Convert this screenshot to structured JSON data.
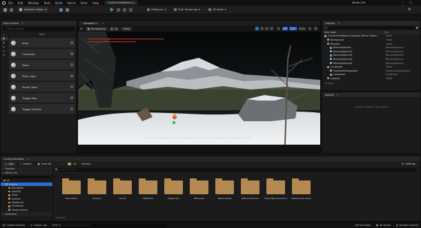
{
  "menu": [
    "File",
    "Edit",
    "Window",
    "Tools",
    "Build",
    "Select",
    "Actor",
    "Help"
  ],
  "project_tab": "ConiferForestBiome_S",
  "window_title": "Winter_Fire",
  "toolbar": {
    "mode": "Selection Mode",
    "platforms": "Platforms",
    "pixel_streaming": "Pixel Streaming",
    "vr_mode": "VR Mode"
  },
  "place_actors": {
    "title": "Place Actors",
    "search_placeholder": "Search Classes",
    "categories": [
      "Basic",
      "Lights",
      "Shapes",
      "Visual",
      "Volumes",
      "All Classes"
    ],
    "section_label": "Basic",
    "items": [
      "Actor",
      "Character",
      "Pawn",
      "Point Light",
      "Player Start",
      "Trigger Box",
      "Trigger Sphere"
    ]
  },
  "viewport": {
    "tab": "Viewport 1",
    "perspective": "Perspective",
    "lit": "Lit",
    "show": "Show",
    "grid_snap": "10",
    "rot_snap": "10°",
    "scale_snap": "0.25",
    "camera_speed": "4",
    "message": "No active Level Sequencer Editor detected. Please edit a Level Sequence to enable full controls."
  },
  "outliner": {
    "title": "Outliner",
    "col_label": "Item Label",
    "col_type": "Type",
    "rows": [
      {
        "label": "ConiferForestBiome_Example_Winter (Editor)",
        "type": "World",
        "indent": 0
      },
      {
        "label": "Background",
        "type": "Folder",
        "indent": 1
      },
      {
        "label": "Blockers",
        "type": "Folder",
        "indent": 1
      },
      {
        "label": "BlockingVolume",
        "type": "BlockingVolume",
        "indent": 2
      },
      {
        "label": "BlockingVolume2",
        "type": "BlockingVolume",
        "indent": 2
      },
      {
        "label": "BlockingVolume3",
        "type": "BlockingVolume",
        "indent": 2
      },
      {
        "label": "BlockingVolume4",
        "type": "BlockingVolume",
        "indent": 2
      },
      {
        "label": "BlockingVolume5",
        "type": "BlockingVolume",
        "indent": 2
      },
      {
        "label": "Landscape",
        "type": "Folder",
        "indent": 1
      },
      {
        "label": "InstancedFoliageActor",
        "type": "InstancedFoliageActor",
        "indent": 2
      },
      {
        "label": "Landscape",
        "type": "Landscape",
        "indent": 2
      },
      {
        "label": "Lighting",
        "type": "Folder",
        "indent": 1
      }
    ],
    "count": "78 actors"
  },
  "details": {
    "title": "Details",
    "empty": "Select an object to view details."
  },
  "content_browser": {
    "title": "Content Browser",
    "add": "Add",
    "import": "Import",
    "save_all": "Save All",
    "path_all": "All",
    "path_content": "Content",
    "settings": "Settings",
    "favorites": "Favorites",
    "project": "Winter_Fire",
    "tree": [
      "All",
      "Content",
      "BlackWater",
      "EasyFog",
      "Fauna",
      "FirePack",
      "Megascans",
      "PCGWorlds",
      "StarterContent"
    ],
    "search_placeholder": "Search Content",
    "folders": [
      "BlackWater",
      "EasyFog",
      "FauIne",
      "FIREPACK1",
      "Megascans",
      "MSPresets",
      "NMChristmas",
      "NMConiferForest",
      "PhysicsBlockGenerics",
      "PWAdvanced Pack2"
    ],
    "item_count": "10 items",
    "collections": "Collections"
  },
  "statusbar": {
    "drawer": "Content Drawer",
    "output_log": "Output Log",
    "cmd": "Cmd",
    "console_placeholder": "Enter Console Command",
    "derived": "Derived Data",
    "unsaved": "All Saved",
    "revision": "Revision Control"
  },
  "colors": {
    "accent_blue": "#2a6fd6",
    "folder": "#b48a52",
    "play_green": "#3fb44a"
  }
}
